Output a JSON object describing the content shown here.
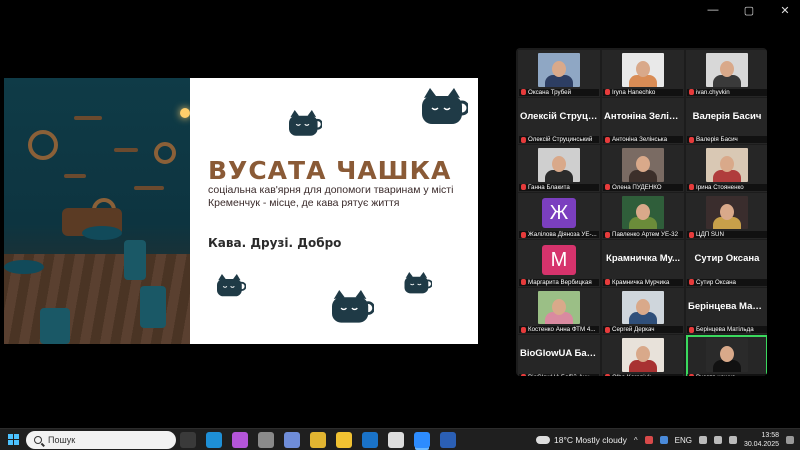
{
  "slide": {
    "title": "ВУСАТА ЧАШКА",
    "subtitle": "соціальна кав'ярня для допомоги тваринам у місті Кременчук - місце, де кава рятує життя",
    "tagline": "Кава. Друзі. Добро"
  },
  "participants": [
    {
      "display": "video",
      "name": "Оксана Трубей",
      "bg": "#8fa7c4",
      "shirt": "#2d3e63"
    },
    {
      "display": "video",
      "name": "Iryna Hanechko",
      "bg": "#e9e9e9",
      "shirt": "#d98c55"
    },
    {
      "display": "video",
      "name": "ivan.chyvkin",
      "bg": "#d8d8d8",
      "shirt": "#3a3a3a"
    },
    {
      "display": "text",
      "big": "Олексій Струци...",
      "name": "Олексій Струцинський"
    },
    {
      "display": "text",
      "big": "Антоніна Зелін...",
      "name": "Антоніна Зелінська"
    },
    {
      "display": "text",
      "big": "Валерія Басич",
      "name": "Валерія Басич"
    },
    {
      "display": "video",
      "name": "Ганна Блакита",
      "bg": "#cfcfcf",
      "shirt": "#2b2b2b"
    },
    {
      "display": "video",
      "name": "Олена ПУДЕНКО",
      "bg": "#7a6b63",
      "shirt": "#3c2f2a"
    },
    {
      "display": "video",
      "name": "Ірина Стояненко",
      "bg": "#d9c8b4",
      "shirt": "#b03c3c"
    },
    {
      "display": "letter",
      "letter": "Ж",
      "color": "#7b3fbf",
      "name": "Жалілова Діяноза УЕ-..."
    },
    {
      "display": "video",
      "name": "Павленко Артем УЕ-32",
      "bg": "#2f5e3a",
      "shirt": "#6b8c3a"
    },
    {
      "display": "video",
      "name": "ЦДП SUN",
      "bg": "#3a2d2d",
      "shirt": "#c8a04a"
    },
    {
      "display": "letter",
      "letter": "М",
      "color": "#d6336c",
      "name": "Маргарита Вербицкая"
    },
    {
      "display": "text",
      "big": "Крамничка Му...",
      "name": "Крамничка Мурчика"
    },
    {
      "display": "text",
      "big": "Сутир Оксана",
      "name": "Сутир Оксана"
    },
    {
      "display": "video",
      "name": "Костенко Анна ФТМ 4...",
      "bg": "#9bbf86",
      "shirt": "#d98aa0"
    },
    {
      "display": "video",
      "name": "Сергей Деркач",
      "bg": "#cfd6dc",
      "shirt": "#2f4f7a"
    },
    {
      "display": "text",
      "big": "Берінцева Маті...",
      "name": "Берінцева Матільда"
    },
    {
      "display": "text",
      "big": "BioGlowUA Баб...",
      "name": "BioGlowUA Бабій Анн..."
    },
    {
      "display": "video",
      "name": "Olha Koreniuk",
      "bg": "#e8e2da",
      "shirt": "#a83232"
    },
    {
      "display": "video",
      "name": "Вусата чашка",
      "bg": "#2a2a2a",
      "shirt": "#111111",
      "active": true
    }
  ],
  "taskbar": {
    "search_label": "Пошук",
    "apps": [
      {
        "icon": "task-view-icon",
        "color": "#3a3a3a"
      },
      {
        "icon": "edge-icon",
        "color": "#1e8fd6"
      },
      {
        "icon": "copilot-icon",
        "color": "#b455d9"
      },
      {
        "icon": "store-icon",
        "color": "#8a8a8a"
      },
      {
        "icon": "photos-icon",
        "color": "#6f8dd9"
      },
      {
        "icon": "chrome-icon",
        "color": "#e2b531"
      },
      {
        "icon": "file-explorer-icon",
        "color": "#f1c232"
      },
      {
        "icon": "outlook-icon",
        "color": "#1a73c9"
      },
      {
        "icon": "dell-icon",
        "color": "#dddddd"
      },
      {
        "icon": "zoom-icon",
        "color": "#2d8cff",
        "active": true
      },
      {
        "icon": "word-icon",
        "color": "#2b5fb4"
      }
    ],
    "weather": "18°C  Mostly cloudy",
    "lang": "ENG",
    "time": "13:58",
    "date": "30.04.2025"
  }
}
